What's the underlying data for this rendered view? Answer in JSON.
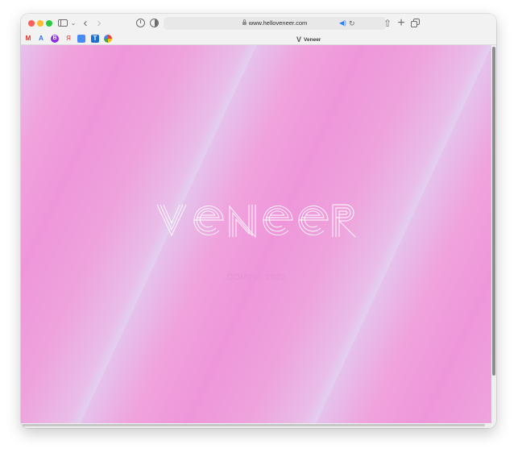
{
  "browser": {
    "url": "www.helloveneer.com",
    "tab_title": "Veneer",
    "favorites": [
      {
        "label": "M",
        "icon": "gmail-icon"
      },
      {
        "label": "A",
        "icon": "atlassian-icon"
      },
      {
        "label": "B",
        "icon": "b-icon"
      },
      {
        "label": "Я",
        "icon": "yandex-icon"
      },
      {
        "label": "",
        "icon": "docs-icon"
      },
      {
        "label": "T",
        "icon": "t-icon"
      },
      {
        "label": "",
        "icon": "photos-icon"
      }
    ]
  },
  "page": {
    "logo_text": "veneer",
    "tagline": "COMING 2022"
  },
  "colors": {
    "background_pink": "#ee97da",
    "background_lavender": "#e3d0ef",
    "logo_stroke": "#ffffff",
    "tagline": "#e494d6"
  }
}
